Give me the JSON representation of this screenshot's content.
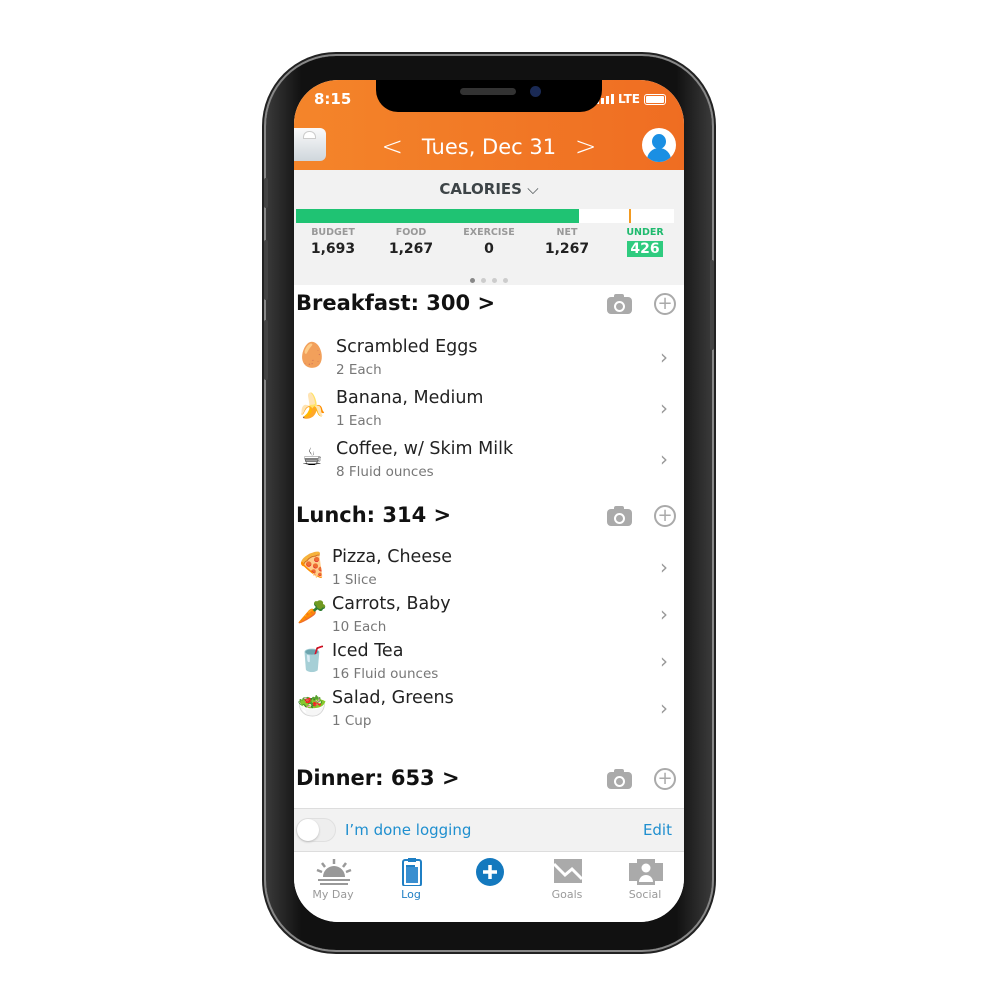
{
  "status_bar": {
    "time": "8:15",
    "network": "LTE"
  },
  "header": {
    "date": "Tues, Dec 31",
    "prev_icon": "chevron-left-icon",
    "next_icon": "chevron-right-icon"
  },
  "calories": {
    "title": "CALORIES",
    "progress_percent": 74.8,
    "budget_marker_percent": 88,
    "stats": [
      {
        "label": "BUDGET",
        "value": "1,693"
      },
      {
        "label": "FOOD",
        "value": "1,267"
      },
      {
        "label": "EXERCISE",
        "value": "0"
      },
      {
        "label": "NET",
        "value": "1,267"
      },
      {
        "label": "UNDER",
        "value": "426"
      }
    ],
    "page_dots": 4,
    "active_dot": 0
  },
  "meals": [
    {
      "title": "Breakfast: 300 >",
      "items": [
        {
          "emoji": "🥚",
          "name": "Scrambled Eggs",
          "qty": "2 Each"
        },
        {
          "emoji": "🍌",
          "name": "Banana, Medium",
          "qty": "1 Each"
        },
        {
          "emoji": "☕",
          "name": "Coffee, w/ Skim Milk",
          "qty": "8 Fluid ounces"
        }
      ]
    },
    {
      "title": "Lunch: 314 >",
      "items": [
        {
          "emoji": "🍕",
          "name": "Pizza, Cheese",
          "qty": "1 Slice"
        },
        {
          "emoji": "🥕",
          "name": "Carrots, Baby",
          "qty": "10 Each"
        },
        {
          "emoji": "🥤",
          "name": "Iced Tea",
          "qty": "16 Fluid ounces"
        },
        {
          "emoji": "🥗",
          "name": "Salad, Greens",
          "qty": "1 Cup"
        }
      ]
    },
    {
      "title": "Dinner: 653 >",
      "items": []
    }
  ],
  "footer": {
    "done_label": "I’m done logging",
    "done_checked": false,
    "edit_label": "Edit"
  },
  "tabs": [
    {
      "label": "My Day",
      "active": false
    },
    {
      "label": "Log",
      "active": true
    },
    {
      "label": "",
      "active": false
    },
    {
      "label": "Goals",
      "active": false
    },
    {
      "label": "Social",
      "active": false
    }
  ],
  "colors": {
    "header": "#f07a26",
    "progress": "#1fc373",
    "accent": "#1f8fcf",
    "under": "#2fcb7f"
  }
}
